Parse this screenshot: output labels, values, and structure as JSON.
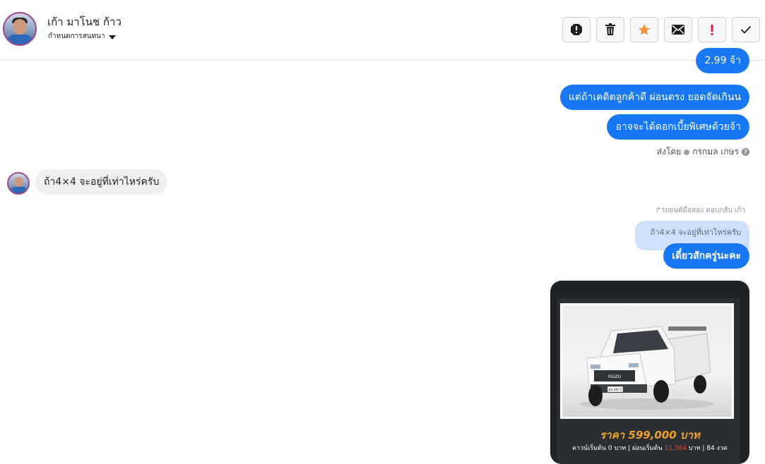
{
  "header": {
    "contact_name": "เก้า มาโนช ก้าว",
    "subtitle": "กำหนดการสนทนา"
  },
  "actions": [
    {
      "name": "report-icon",
      "label": "!"
    },
    {
      "name": "trash-icon"
    },
    {
      "name": "star-icon",
      "color": "#f7923a"
    },
    {
      "name": "envelope-icon"
    },
    {
      "name": "exclamation-icon",
      "color": "#e41e3f",
      "label": "!"
    },
    {
      "name": "check-icon"
    }
  ],
  "messages": {
    "out_partial": "2.99 จ้า",
    "out_1": "แต่ถ้าเคดิตลูกค้าดี ผ่อนตรง ยอดจัดเกินน",
    "out_2": "อาจจะได้ดอกเบี้ยพิเศษด้วยจ้า",
    "sent_by_prefix": "ส่งโดย",
    "sent_by_name": "กรกมล เกษร",
    "in_1": "ถ้า4×4 จะอยู่ที่เท่าไหร่ครับ",
    "reply_note": "รถยนต์มือสอง ตอบกลับ เก้า",
    "quoted_text": "ถ้า4×4 จะอยู่ที่เท่าไหร่ครับ",
    "out_3": "เดี๋ยวสักครู่นะคะ"
  },
  "card": {
    "price": "ราคา 599,000 บาท",
    "terms_a": "ดาวน์เริ่มต้น 0 บาท | ผ่อนเริ่มต้น ",
    "terms_amount": "11,364",
    "terms_b": " บาท | 84 งวด",
    "plate": "ฮพ 8877"
  },
  "colors": {
    "brand_blue": "#1877f2",
    "incoming_bg": "#f1f0f0",
    "price_orange": "#f0a32a"
  }
}
